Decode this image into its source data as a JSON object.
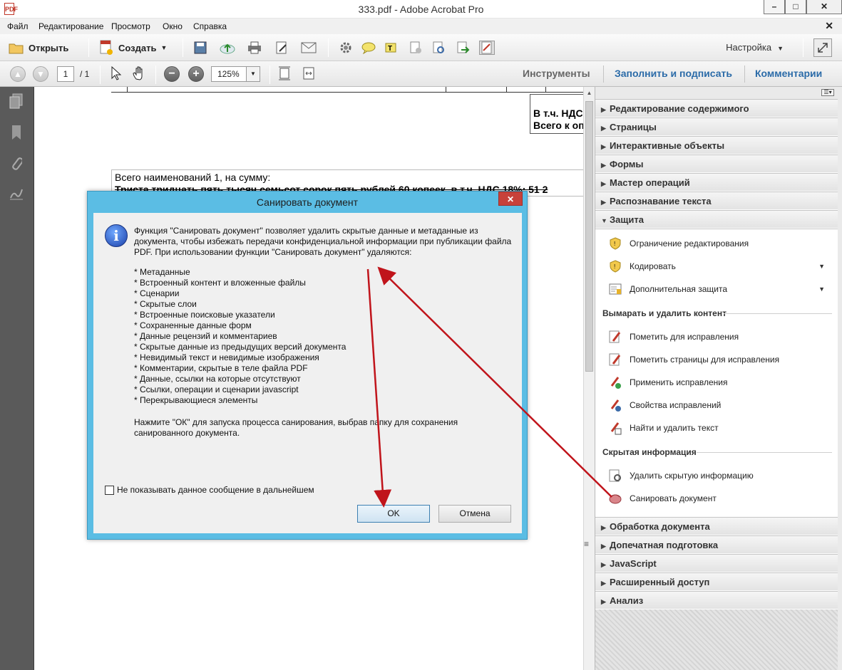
{
  "window": {
    "title": "333.pdf - Adobe Acrobat Pro",
    "app_icon_text": "PDF"
  },
  "menu": [
    "Файл",
    "Редактирование",
    "Просмотр",
    "Окно",
    "Справка"
  ],
  "toolbar": {
    "open_label": "Открыть",
    "create_label": "Создать",
    "setup_label": "Настройка"
  },
  "nav": {
    "page_current": "1",
    "page_total": "/ 1",
    "zoom": "125%"
  },
  "pane_tabs": {
    "tools": "Инструменты",
    "fill_sign": "Заполнить и подписать",
    "comments": "Комментарии"
  },
  "document": {
    "vat_line": "В т.ч. НДС",
    "total_line": "Всего к оплате",
    "items_line": "Всего наименований 1, на сумму:",
    "amount_line": "Триста тридцать пять тысяч семьсот сорок пять рублей 60 копеек, в т.ч. НДС 18%: 51 2"
  },
  "panel": {
    "sections_top": [
      "Редактирование содержимого",
      "Страницы",
      "Интерактивные объекты",
      "Формы",
      "Мастер операций",
      "Распознавание текста"
    ],
    "protection": "Защита",
    "protection_items": [
      "Ограничение редактирования",
      "Кодировать",
      "Дополнительная защита"
    ],
    "redact_header": "Вымарать и удалить контент",
    "redact_items": [
      "Пометить для исправления",
      "Пометить страницы для исправления",
      "Применить исправления",
      "Свойства исправлений",
      "Найти и удалить текст"
    ],
    "hidden_header": "Скрытая информация",
    "hidden_items": [
      "Удалить скрытую информацию",
      "Санировать документ"
    ],
    "sections_bottom": [
      "Обработка документа",
      "Допечатная подготовка",
      "JavaScript",
      "Расширенный доступ",
      "Анализ"
    ]
  },
  "dialog": {
    "title": "Санировать документ",
    "close": "✕",
    "intro": "Функция \"Санировать документ\" позволяет удалить скрытые данные и метаданные из документа, чтобы избежать передачи конфиденциальной информации при публикации файла PDF. При использовании функции \"Санировать документ\" удаляются:",
    "items": [
      "* Метаданные",
      "* Встроенный контент и вложенные файлы",
      "* Сценарии",
      "* Скрытые слои",
      "* Встроенные поисковые указатели",
      "* Сохраненные данные форм",
      "* Данные рецензий и комментариев",
      "* Скрытые данные из предыдущих версий документа",
      "* Невидимый текст и невидимые изображения",
      "* Комментарии, скрытые в теле файла PDF",
      "* Данные, ссылки на которые отсутствуют",
      "* Ссылки, операции и сценарии javascript",
      "* Перекрывающиеся элементы"
    ],
    "note": "Нажмите \"ОК\" для запуска процесса санирования, выбрав папку для сохранения санированного документа.",
    "checkbox": "Не показывать данное сообщение в дальнейшем",
    "ok": "OK",
    "cancel": "Отмена"
  },
  "colors": {
    "accent": "#5bbde4",
    "annotation_arrow": "#c0141b",
    "tab_blue": "#2b6ba8"
  }
}
